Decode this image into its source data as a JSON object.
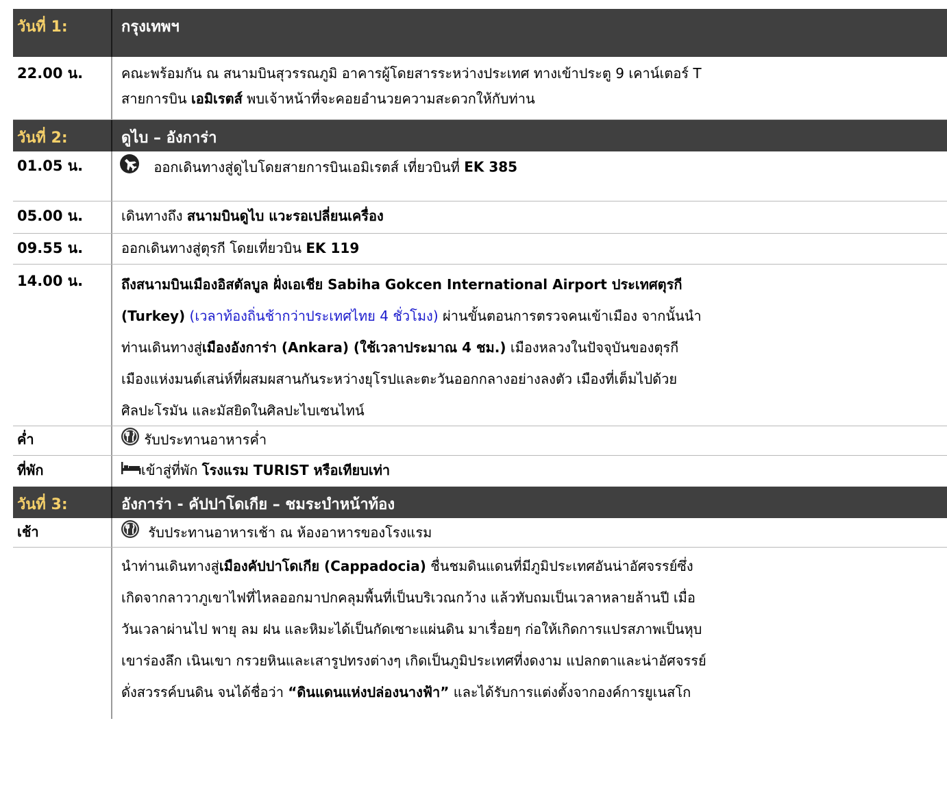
{
  "day1": {
    "label": "วันที่ 1:",
    "title": "กรุงเทพฯ",
    "rows": [
      {
        "time": "22.00 น.",
        "line1": "คณะพร้อมกัน ณ สนามบินสุวรรณภูมิ อาคารผู้โดยสารระหว่างประเทศ ทางเข้าประตู 9 เคาน์เตอร์ T",
        "line2_pre": "สายการบิน ",
        "line2_bold": "เอมิเรตส์",
        "line2_post": " พบเจ้าหน้าที่จะคอยอำนวยความสะดวกให้กับท่าน"
      }
    ]
  },
  "day2": {
    "label": "วันที่ 2:",
    "title": "ดูไบ – อังการ่า",
    "r1": {
      "time": "01.05 น.",
      "text": "ออกเดินทางสู่ดูไบโดยสายการบินเอมิเรตส์ เที่ยวบินที่ ",
      "bold": "EK 385"
    },
    "r2": {
      "time": "05.00 น.",
      "text": "เดินทางถึง ",
      "bold": "สนามบินดูไบ แวะรอเปลี่ยนเครื่อง"
    },
    "r3": {
      "time": "09.55 น.",
      "text": "ออกเดินทางสู่ตุรกี โดยเที่ยวบิน ",
      "bold": "EK 119"
    },
    "r4": {
      "time": "14.00 น.",
      "l1_a": "ถึง",
      "l1_b": "สนามบินเมืองอิสตัลบูล ฝั่งเอเชีย Sabiha Gokcen International Airport",
      "l1_c": " ประเทศตุรกี",
      "l2_a": "(Turkey)",
      "l2_blue": " (เวลาท้องถิ่นช้ากว่าประเทศไทย 4 ชั่วโมง)",
      "l2_c": " ผ่านขั้นตอนการตรวจคนเข้าเมือง จากนั้นนำ",
      "l3_a": "ท่านเดินทางสู่",
      "l3_b": "เมืองอังการ่า (Ankara)  (ใช้เวลาประมาณ 4 ชม.)",
      "l3_c": " เมืองหลวงในปัจจุบันของตุรกี",
      "l4": "เมืองแห่งมนต์เสน่ห์ที่ผสมผสานกันระหว่างยุโรปและตะวันออกกลางอย่างลงตัว เมืองที่เต็มไปด้วย",
      "l5": "ศิลปะโรมัน และมัสยิดในศิลปะไบเซนไทน์"
    },
    "r5": {
      "time": "ค่ำ",
      "text": "รับประทานอาหารค่ำ"
    },
    "r6": {
      "time": "ที่พัก",
      "text": "เข้าสู่ที่พัก ",
      "bold": "โรงแรม TURIST หรือเทียบเท่า"
    }
  },
  "day3": {
    "label": "วันที่ 3:",
    "title": "อังการ่า - คัปปาโดเกีย – ชมระบำหน้าท้อง",
    "r1": {
      "time": "เช้า",
      "text": "รับประทานอาหารเช้า ณ ห้องอาหารของโรงแรม"
    },
    "r2": {
      "l1_a": "นำท่านเดินทางสู่",
      "l1_b": "เมืองคัปปาโดเกีย (Cappadocia)",
      "l1_c": " ชื่นชมดินแดนที่มีภูมิประเทศอันน่าอัศจรรย์ซึ่ง",
      "l2": "เกิดจากลาวาภูเขาไฟที่ไหลออกมาปกคลุมพื้นที่เป็นบริเวณกว้าง แล้วทับถมเป็นเวลาหลายล้านปี  เมื่อ",
      "l3": "วันเวลาผ่านไป พายุ ลม ฝน และหิมะได้เป็นกัดเซาะแผ่นดิน มาเรื่อยๆ ก่อให้เกิดการแปรสภาพเป็นหุบ",
      "l4": "เขาร่องลึก เนินเขา กรวยหินและเสารูปทรงต่างๆ เกิดเป็นภูมิประเทศที่งดงาม แปลกตาและน่าอัศจรรย์",
      "l5_a": "ดั่งสวรรค์บนดิน จนได้ชื่อว่า ",
      "l5_b": "“ดินแดนแห่งปล่องนางฟ้า”",
      "l5_c": "  และได้รับการแต่งตั้งจากองค์การยูเนสโก"
    }
  },
  "icons": [
    "airplane-icon",
    "restaurant-icon",
    "bed-icon"
  ]
}
